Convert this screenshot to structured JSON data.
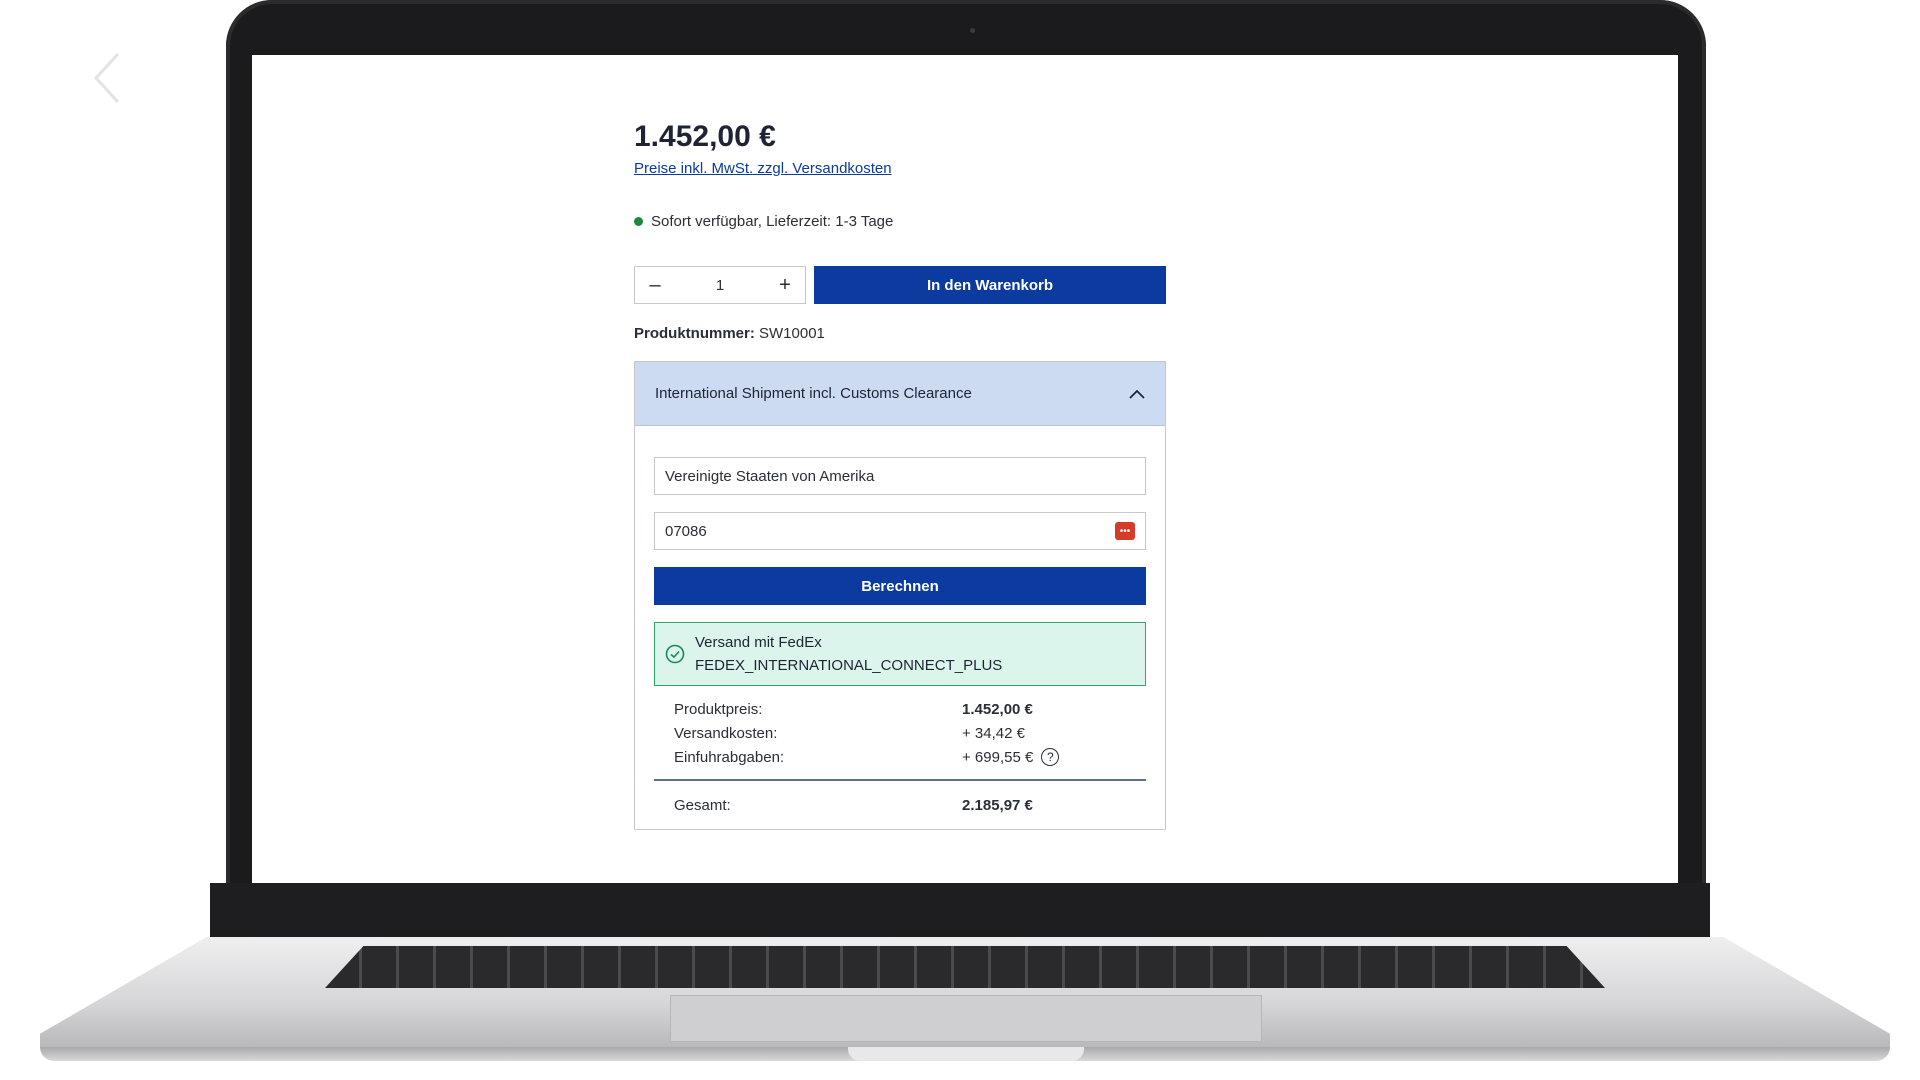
{
  "product": {
    "price": "1.452,00 €",
    "price_note": "Preise inkl. MwSt. zzgl. Versandkosten",
    "availability": "Sofort verfügbar, Lieferzeit: 1-3 Tage",
    "quantity": "1",
    "qty_minus": "–",
    "qty_plus": "+",
    "add_to_cart": "In den Warenkorb",
    "product_number_label": "Produktnummer:",
    "product_number": "SW10001"
  },
  "shipment": {
    "title": "International Shipment incl. Customs Clearance",
    "country": "Vereinigte Staaten von Amerika",
    "zip": "07086",
    "calculate": "Berechnen",
    "carrier_line1": "Versand mit FedEx",
    "carrier_line2": "FEDEX_INTERNATIONAL_CONNECT_PLUS",
    "rows": [
      {
        "label": "Produktpreis:",
        "value": "1.452,00 €"
      },
      {
        "label": "Versandkosten:",
        "value": "+ 34,42 €"
      },
      {
        "label": "Einfuhrabgaben:",
        "value": "+ 699,55 €"
      }
    ],
    "total_label": "Gesamt:",
    "total_value": "2.185,97 €"
  },
  "colors": {
    "primary": "#0b3b9e",
    "panel_header": "#ccdaf2",
    "success_bg": "#dcf5ec",
    "success_border": "#2fa46b",
    "availability_dot": "#1a8a3a"
  },
  "icons": {
    "back": "chevron-left-icon",
    "collapse": "chevron-up-icon",
    "password_manager": "password-manager-icon",
    "success": "check-circle-icon",
    "help": "question-circle-icon"
  }
}
